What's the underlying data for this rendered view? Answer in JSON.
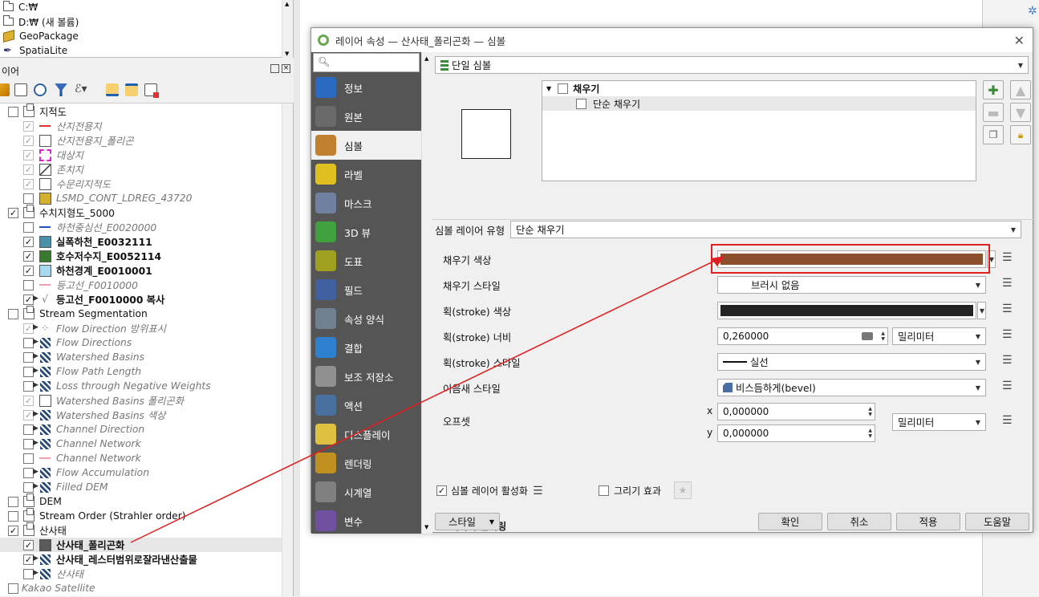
{
  "browser": {
    "items": [
      {
        "label": "C:₩",
        "icon": "folder-icon"
      },
      {
        "label": "D:₩ (새 볼륨)",
        "icon": "folder-icon"
      },
      {
        "label": "GeoPackage",
        "icon": "geopackage-icon"
      },
      {
        "label": "SpatiaLite",
        "icon": "spatialite-icon"
      }
    ]
  },
  "layers_panel": {
    "title": "이어",
    "layers": [
      {
        "label": "지적도",
        "checked": false,
        "style": "normal",
        "icon": "group-icon"
      },
      {
        "label": "산지전용지",
        "checked": true,
        "style": "italic",
        "icon": "line-red"
      },
      {
        "label": "산지전용지_폴리곤",
        "checked": true,
        "style": "italic",
        "icon": "polygon-white"
      },
      {
        "label": "대상지",
        "checked": true,
        "style": "italic",
        "icon": "polygon-magenta-dashed"
      },
      {
        "label": "존치지",
        "checked": true,
        "style": "italic",
        "icon": "polygon-hatched"
      },
      {
        "label": "수문리지적도",
        "checked": true,
        "style": "italic",
        "icon": "polygon-white"
      },
      {
        "label": "LSMD_CONT_LDREG_43720",
        "checked": false,
        "style": "italic",
        "icon": "polygon-gold"
      },
      {
        "label": "수치지형도_5000",
        "checked": true,
        "style": "normal",
        "icon": "group-icon"
      },
      {
        "label": "하천중심선_E0020000",
        "checked": false,
        "style": "italic",
        "icon": "line-blue"
      },
      {
        "label": "실폭하천_E0032111",
        "checked": true,
        "style": "bold",
        "icon": "polygon-teal"
      },
      {
        "label": "호수저수지_E0052114",
        "checked": true,
        "style": "bold",
        "icon": "polygon-green"
      },
      {
        "label": "하천경계_E0010001",
        "checked": true,
        "style": "bold",
        "icon": "polygon-lightblue"
      },
      {
        "label": "등고선_F0010000",
        "checked": false,
        "style": "italic",
        "icon": "line-pink"
      },
      {
        "label": "등고선_F0010000 복사",
        "checked": true,
        "style": "bold",
        "icon": "contour-icon"
      },
      {
        "label": "Stream Segmentation",
        "checked": false,
        "style": "normal",
        "icon": "group-icon"
      },
      {
        "label": "Flow Direction 방위표시",
        "checked": true,
        "style": "italic",
        "icon": "points-icon"
      },
      {
        "label": "Flow Directions",
        "checked": false,
        "style": "italic",
        "icon": "raster-icon"
      },
      {
        "label": "Watershed Basins",
        "checked": false,
        "style": "italic",
        "icon": "raster-icon"
      },
      {
        "label": "Flow Path Length",
        "checked": false,
        "style": "italic",
        "icon": "raster-icon"
      },
      {
        "label": "Loss through Negative Weights",
        "checked": false,
        "style": "italic",
        "icon": "raster-icon"
      },
      {
        "label": "Watershed Basins 폴리곤화",
        "checked": true,
        "style": "italic",
        "icon": "polygon-white"
      },
      {
        "label": "Watershed Basins 색상",
        "checked": true,
        "style": "italic",
        "icon": "raster-icon"
      },
      {
        "label": "Channel Direction",
        "checked": false,
        "style": "italic",
        "icon": "raster-icon"
      },
      {
        "label": "Channel Network",
        "checked": false,
        "style": "italic",
        "icon": "raster-icon"
      },
      {
        "label": "Channel Network",
        "checked": false,
        "style": "italic",
        "icon": "line-pink"
      },
      {
        "label": "Flow Accumulation",
        "checked": false,
        "style": "italic",
        "icon": "raster-icon"
      },
      {
        "label": "Filled DEM",
        "checked": false,
        "style": "italic",
        "icon": "raster-icon"
      },
      {
        "label": "DEM",
        "checked": false,
        "style": "normal",
        "icon": "group-icon"
      },
      {
        "label": "Stream Order (Strahler order)",
        "checked": false,
        "style": "normal",
        "icon": "group-icon"
      },
      {
        "label": "산사태",
        "checked": true,
        "style": "normal",
        "icon": "group-icon"
      },
      {
        "label": "산사태_폴리곤화",
        "checked": true,
        "style": "bold",
        "icon": "polygon-gray"
      },
      {
        "label": "산사태_레스터범위로잘라낸산출물",
        "checked": true,
        "style": "bold",
        "icon": "raster-icon"
      },
      {
        "label": "산사태",
        "checked": false,
        "style": "italic",
        "icon": "raster-icon"
      },
      {
        "label": "Kakao Satellite",
        "checked": false,
        "style": "italic",
        "icon": "none"
      }
    ]
  },
  "dialog": {
    "title": "레이어 속성 — 산사태_폴리곤화 — 심볼",
    "nav": [
      {
        "label": "정보",
        "icon": "info-icon"
      },
      {
        "label": "원본",
        "icon": "source-icon"
      },
      {
        "label": "심볼",
        "icon": "symbology-icon"
      },
      {
        "label": "라벨",
        "icon": "labels-icon"
      },
      {
        "label": "마스크",
        "icon": "mask-icon"
      },
      {
        "label": "3D 뷰",
        "icon": "3d-icon"
      },
      {
        "label": "도표",
        "icon": "diagram-icon"
      },
      {
        "label": "필드",
        "icon": "fields-icon"
      },
      {
        "label": "속성 양식",
        "icon": "form-icon"
      },
      {
        "label": "결합",
        "icon": "join-icon"
      },
      {
        "label": "보조 저장소",
        "icon": "storage-icon"
      },
      {
        "label": "액션",
        "icon": "action-icon"
      },
      {
        "label": "디스플레이",
        "icon": "display-icon"
      },
      {
        "label": "렌더링",
        "icon": "rendering-icon"
      },
      {
        "label": "시계열",
        "icon": "temporal-icon"
      },
      {
        "label": "변수",
        "icon": "variables-icon"
      }
    ],
    "renderer": "단일 심볼",
    "tree": {
      "parent": "채우기",
      "child": "단순 채우기"
    },
    "symbol_layer_type_label": "심볼 레이어 유형",
    "symbol_layer_type": "단순 채우기",
    "fill_color_label": "채우기 색상",
    "fill_color": "#8b4f2b",
    "fill_style_label": "채우기 스타일",
    "fill_style": "브러시 없음",
    "stroke_color_label": "획(stroke) 색상",
    "stroke_color": "#232323",
    "stroke_width_label": "획(stroke) 너비",
    "stroke_width": "0,260000",
    "stroke_unit": "밀리미터",
    "stroke_style_label": "획(stroke) 스타일",
    "stroke_style": "실선",
    "join_style_label": "이음새 스타일",
    "join_style": "비스듬하게(bevel)",
    "offset_label": "오프셋",
    "offset_x_label": "x",
    "offset_x": "0,000000",
    "offset_y_label": "y",
    "offset_y": "0,000000",
    "offset_unit": "밀리미터",
    "enable_layer_label": "심볼 레이어 활성화",
    "enable_layer_checked": true,
    "draw_effects_label": "그리기 효과",
    "draw_effects_checked": false,
    "layer_rendering_label": "레이어 렌더링",
    "style_button": "스타일",
    "buttons": {
      "ok": "확인",
      "cancel": "취소",
      "apply": "적용",
      "help": "도움말"
    }
  },
  "annotation": {
    "color": "#e02020"
  }
}
